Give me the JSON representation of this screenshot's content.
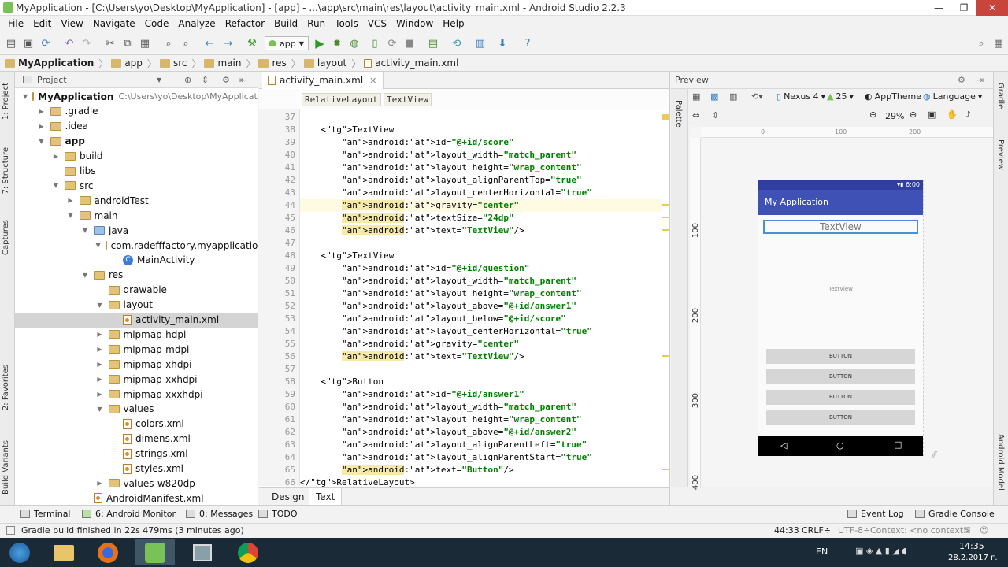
{
  "window": {
    "title": "MyApplication - [C:\\Users\\yo\\Desktop\\MyApplication] - [app] - ...\\app\\src\\main\\res\\layout\\activity_main.xml - Android Studio 2.2.3",
    "min_icon": "minimize-icon",
    "max_icon": "maximize-icon",
    "close_icon": "close-icon"
  },
  "menu": [
    "File",
    "Edit",
    "View",
    "Navigate",
    "Code",
    "Analyze",
    "Refactor",
    "Build",
    "Run",
    "Tools",
    "VCS",
    "Window",
    "Help"
  ],
  "toolbar": {
    "run_config": "app"
  },
  "breadcrumb": [
    "MyApplication",
    "app",
    "src",
    "main",
    "res",
    "layout",
    "activity_main.xml"
  ],
  "left_strip": [
    "1: Project",
    "7: Structure",
    "Captures",
    "2: Favorites",
    "Build Variants"
  ],
  "right_strip": [
    "Gradle",
    "Preview",
    "Android Model"
  ],
  "project": {
    "header": "Project",
    "tree": [
      {
        "label": "MyApplication",
        "path": "C:\\Users\\yo\\Desktop\\MyApplication",
        "depth": 0,
        "open": true,
        "icon": "folder",
        "bold": true
      },
      {
        "label": ".gradle",
        "depth": 1,
        "open": false,
        "icon": "folder"
      },
      {
        "label": ".idea",
        "depth": 1,
        "open": false,
        "icon": "folder"
      },
      {
        "label": "app",
        "depth": 1,
        "open": true,
        "icon": "folder",
        "bold": true
      },
      {
        "label": "build",
        "depth": 2,
        "open": false,
        "icon": "folder"
      },
      {
        "label": "libs",
        "depth": 2,
        "leaf": true,
        "icon": "folder"
      },
      {
        "label": "src",
        "depth": 2,
        "open": true,
        "icon": "folder"
      },
      {
        "label": "androidTest",
        "depth": 3,
        "open": false,
        "icon": "folder"
      },
      {
        "label": "main",
        "depth": 3,
        "open": true,
        "icon": "folder"
      },
      {
        "label": "java",
        "depth": 4,
        "open": true,
        "icon": "folder-blue"
      },
      {
        "label": "com.radefffactory.myapplication",
        "depth": 5,
        "open": true,
        "icon": "folder"
      },
      {
        "label": "MainActivity",
        "depth": 6,
        "leaf": true,
        "icon": "class"
      },
      {
        "label": "res",
        "depth": 4,
        "open": true,
        "icon": "folder"
      },
      {
        "label": "drawable",
        "depth": 5,
        "leaf": true,
        "icon": "folder"
      },
      {
        "label": "layout",
        "depth": 5,
        "open": true,
        "icon": "folder"
      },
      {
        "label": "activity_main.xml",
        "depth": 6,
        "leaf": true,
        "icon": "xml",
        "selected": true
      },
      {
        "label": "mipmap-hdpi",
        "depth": 5,
        "open": false,
        "icon": "folder"
      },
      {
        "label": "mipmap-mdpi",
        "depth": 5,
        "open": false,
        "icon": "folder"
      },
      {
        "label": "mipmap-xhdpi",
        "depth": 5,
        "open": false,
        "icon": "folder"
      },
      {
        "label": "mipmap-xxhdpi",
        "depth": 5,
        "open": false,
        "icon": "folder"
      },
      {
        "label": "mipmap-xxxhdpi",
        "depth": 5,
        "open": false,
        "icon": "folder"
      },
      {
        "label": "values",
        "depth": 5,
        "open": true,
        "icon": "folder"
      },
      {
        "label": "colors.xml",
        "depth": 6,
        "leaf": true,
        "icon": "xml"
      },
      {
        "label": "dimens.xml",
        "depth": 6,
        "leaf": true,
        "icon": "xml"
      },
      {
        "label": "strings.xml",
        "depth": 6,
        "leaf": true,
        "icon": "xml"
      },
      {
        "label": "styles.xml",
        "depth": 6,
        "leaf": true,
        "icon": "xml"
      },
      {
        "label": "values-w820dp",
        "depth": 5,
        "open": false,
        "icon": "folder"
      },
      {
        "label": "AndroidManifest.xml",
        "depth": 4,
        "leaf": true,
        "icon": "xml"
      }
    ]
  },
  "editor": {
    "tab": "activity_main.xml",
    "tag_crumbs": [
      "RelativeLayout",
      "TextView"
    ],
    "bottom_tabs": [
      "Design",
      "Text"
    ],
    "active_bottom_tab": "Text",
    "lines": [
      {
        "n": "37",
        "text": ""
      },
      {
        "n": "38",
        "text": "    <TextView"
      },
      {
        "n": "39",
        "text": "        android:id=\"@+id/score\""
      },
      {
        "n": "40",
        "text": "        android:layout_width=\"match_parent\""
      },
      {
        "n": "41",
        "text": "        android:layout_height=\"wrap_content\""
      },
      {
        "n": "42",
        "text": "        android:layout_alignParentTop=\"true\""
      },
      {
        "n": "43",
        "text": "        android:layout_centerHorizontal=\"true\""
      },
      {
        "n": "44",
        "text": "        android:gravity=\"center\"",
        "hl": true,
        "warn": true
      },
      {
        "n": "45",
        "text": "        android:textSize=\"24dp\"",
        "warn": true
      },
      {
        "n": "46",
        "text": "        android:text=\"TextView\"/>",
        "warn": true
      },
      {
        "n": "47",
        "text": ""
      },
      {
        "n": "48",
        "text": "    <TextView"
      },
      {
        "n": "49",
        "text": "        android:id=\"@+id/question\""
      },
      {
        "n": "50",
        "text": "        android:layout_width=\"match_parent\""
      },
      {
        "n": "51",
        "text": "        android:layout_height=\"wrap_content\""
      },
      {
        "n": "52",
        "text": "        android:layout_above=\"@+id/answer1\""
      },
      {
        "n": "53",
        "text": "        android:layout_below=\"@+id/score\""
      },
      {
        "n": "54",
        "text": "        android:layout_centerHorizontal=\"true\""
      },
      {
        "n": "55",
        "text": "        android:gravity=\"center\""
      },
      {
        "n": "56",
        "text": "        android:text=\"TextView\"/>",
        "warn": true
      },
      {
        "n": "57",
        "text": ""
      },
      {
        "n": "58",
        "text": "    <Button"
      },
      {
        "n": "59",
        "text": "        android:id=\"@+id/answer1\""
      },
      {
        "n": "60",
        "text": "        android:layout_width=\"match_parent\""
      },
      {
        "n": "61",
        "text": "        android:layout_height=\"wrap_content\""
      },
      {
        "n": "62",
        "text": "        android:layout_above=\"@+id/answer2\""
      },
      {
        "n": "63",
        "text": "        android:layout_alignParentLeft=\"true\""
      },
      {
        "n": "64",
        "text": "        android:layout_alignParentStart=\"true\""
      },
      {
        "n": "65",
        "text": "        android:text=\"Button\"/>",
        "warn": true
      },
      {
        "n": "66",
        "text": "</RelativeLayout>"
      }
    ]
  },
  "preview": {
    "title": "Preview",
    "palette_label": "Palette",
    "device": "Nexus 4",
    "api": "25",
    "theme": "AppTheme",
    "language": "Language",
    "zoom": "29%",
    "ruler_top": [
      "0",
      "100",
      "200"
    ],
    "ruler_left": [
      "100",
      "200",
      "300",
      "400"
    ],
    "phone": {
      "time": "6:00",
      "app_title": "My Application",
      "score_text": "TextView",
      "question_text": "TextView",
      "buttons": [
        "BUTTON",
        "BUTTON",
        "BUTTON",
        "BUTTON"
      ]
    }
  },
  "bottom_tools": {
    "left": [
      "Terminal",
      "6: Android Monitor",
      "0: Messages",
      "TODO"
    ],
    "right": [
      "Event Log",
      "Gradle Console"
    ]
  },
  "status": {
    "message": "Gradle build finished in 22s 479ms (3 minutes ago)",
    "position": "44:33",
    "line_sep": "CRLF÷",
    "encoding": "UTF-8÷",
    "context": "Context: <no context>"
  },
  "taskbar": {
    "lang": "EN",
    "time": "14:35",
    "date": "28.2.2017 г."
  },
  "colors": {
    "app_bar": "#3f51b5",
    "status_bar": "#303f9f",
    "nav_bar": "#000000",
    "taskbar": "#1a2a36",
    "selection": "#d4d4d4"
  }
}
